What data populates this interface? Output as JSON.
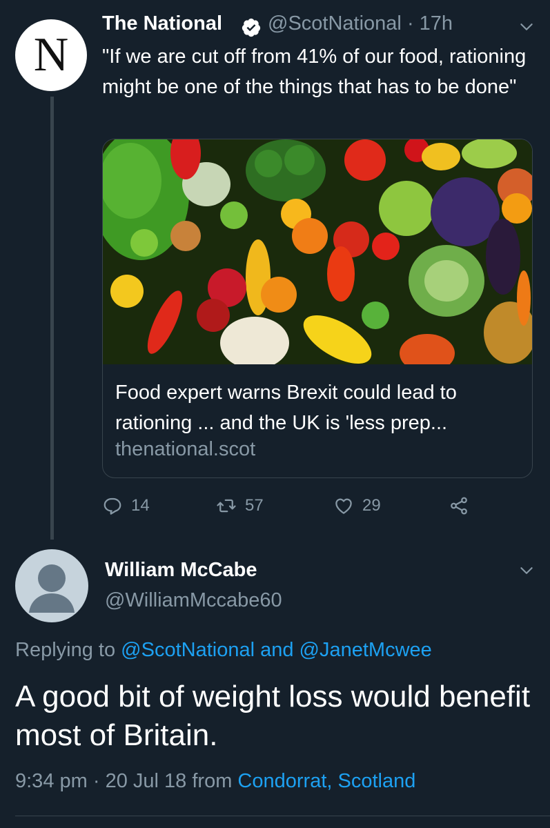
{
  "parent_tweet": {
    "author_name": "The National",
    "author_avatar_letter": "N",
    "handle": "@ScotNational",
    "time_separator": "·",
    "time": "17h",
    "text": "\"If we are cut off from 41% of our food, rationing might be one of the things that has to be done\"",
    "card": {
      "title": "Food expert warns Brexit could lead to rationing ... and the UK is 'less prep...",
      "domain": "thenational.scot"
    },
    "actions": {
      "replies": "14",
      "retweets": "57",
      "likes": "29"
    }
  },
  "reply": {
    "author_name": "William McCabe",
    "handle": "@WilliamMccabe60",
    "replying_prefix": "Replying to",
    "replying_to_1": "@ScotNational",
    "replying_and": "and",
    "replying_to_2": "@JanetMcwee",
    "text": "A good bit of weight loss would benefit most of Britain.",
    "time": "9:34 pm",
    "meta_separator": "·",
    "date": "20 Jul 18",
    "from_label": "from",
    "location": "Condorrat, Scotland"
  },
  "colors": {
    "background": "#15202b",
    "secondary_text": "#8899a6",
    "link": "#1da1f2",
    "border": "#38444d"
  }
}
